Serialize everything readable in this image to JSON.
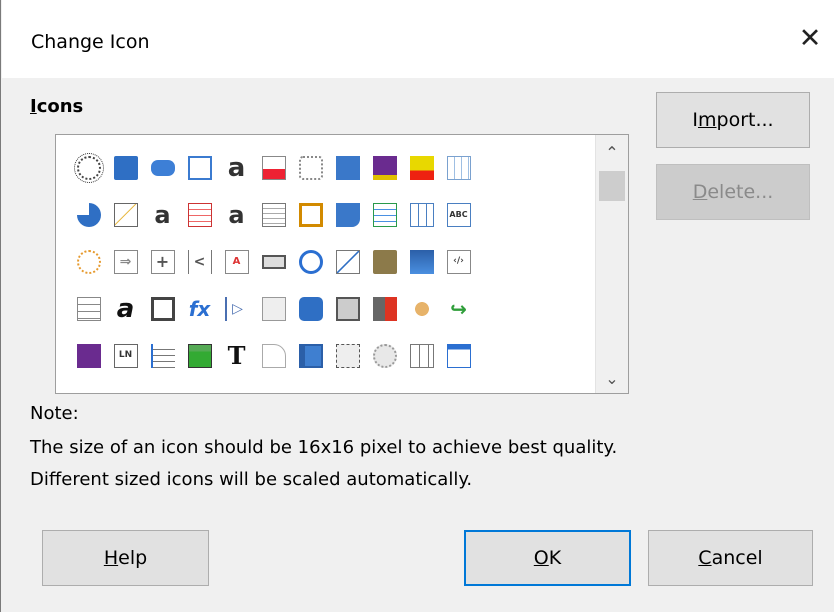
{
  "dialog": {
    "title": "Change Icon",
    "close_glyph": "✕"
  },
  "icons_section": {
    "label": "Icons",
    "mnemonic": "I",
    "label_rest": "cons"
  },
  "icons": [
    [
      "selection-circle-icon",
      "note-icon",
      "rounded-rect-icon",
      "form-doc-icon",
      "text-a-icon",
      "scissors-icon",
      "gear-icon",
      "square-blue-icon",
      "save-pen-icon",
      "highlight-ab-icon",
      "table-icon"
    ],
    [
      "pie-chart-icon",
      "chart-line-icon",
      "text-a-alt-icon",
      "table-orange-icon",
      "text-a-alt2-icon",
      "page-doc-icon",
      "crop-icon",
      "shape-blue-icon",
      "insert-row-icon",
      "grid-icon",
      "abc-icon"
    ],
    [
      "sun-icon",
      "arrow-right-icon",
      "plus-box-icon",
      "bracket-icon",
      "pdf-doc-icon",
      "slider-icon",
      "clock-icon",
      "line-diagonal-icon",
      "folder-icon",
      "blue-panel-icon",
      "code-icon"
    ],
    [
      "list-lines-icon",
      "text-a-bold-icon",
      "printer-icon",
      "fx-icon",
      "triangle-arrow-icon",
      "image-doc-icon",
      "octagon-icon",
      "image-frame-icon",
      "exit-red-icon",
      "curve-icon",
      "arrow-green-icon"
    ],
    [
      "floppy-icon",
      "ln-icon",
      "list-indent-icon",
      "film-green-icon",
      "big-t-icon",
      "shape-curve-icon",
      "frame-icon",
      "image-ruler-icon",
      "gear-grey-icon",
      "columns-icon",
      "arrow-down-box-icon"
    ]
  ],
  "buttons": {
    "import_mnemonic": "m",
    "import_pre": "I",
    "import_post": "port...",
    "delete_mnemonic": "D",
    "delete_post": "elete...",
    "help_mnemonic": "H",
    "help_post": "elp",
    "ok_mnemonic": "O",
    "ok_post": "K",
    "cancel_mnemonic": "C",
    "cancel_post": "ancel"
  },
  "note": {
    "heading": "Note:",
    "line1": "The size of an icon should be 16x16 pixel to achieve best quality.",
    "line2": "Different sized icons will be scaled automatically."
  },
  "scrollbar": {
    "up_glyph": "⌃",
    "down_glyph": "⌄"
  }
}
